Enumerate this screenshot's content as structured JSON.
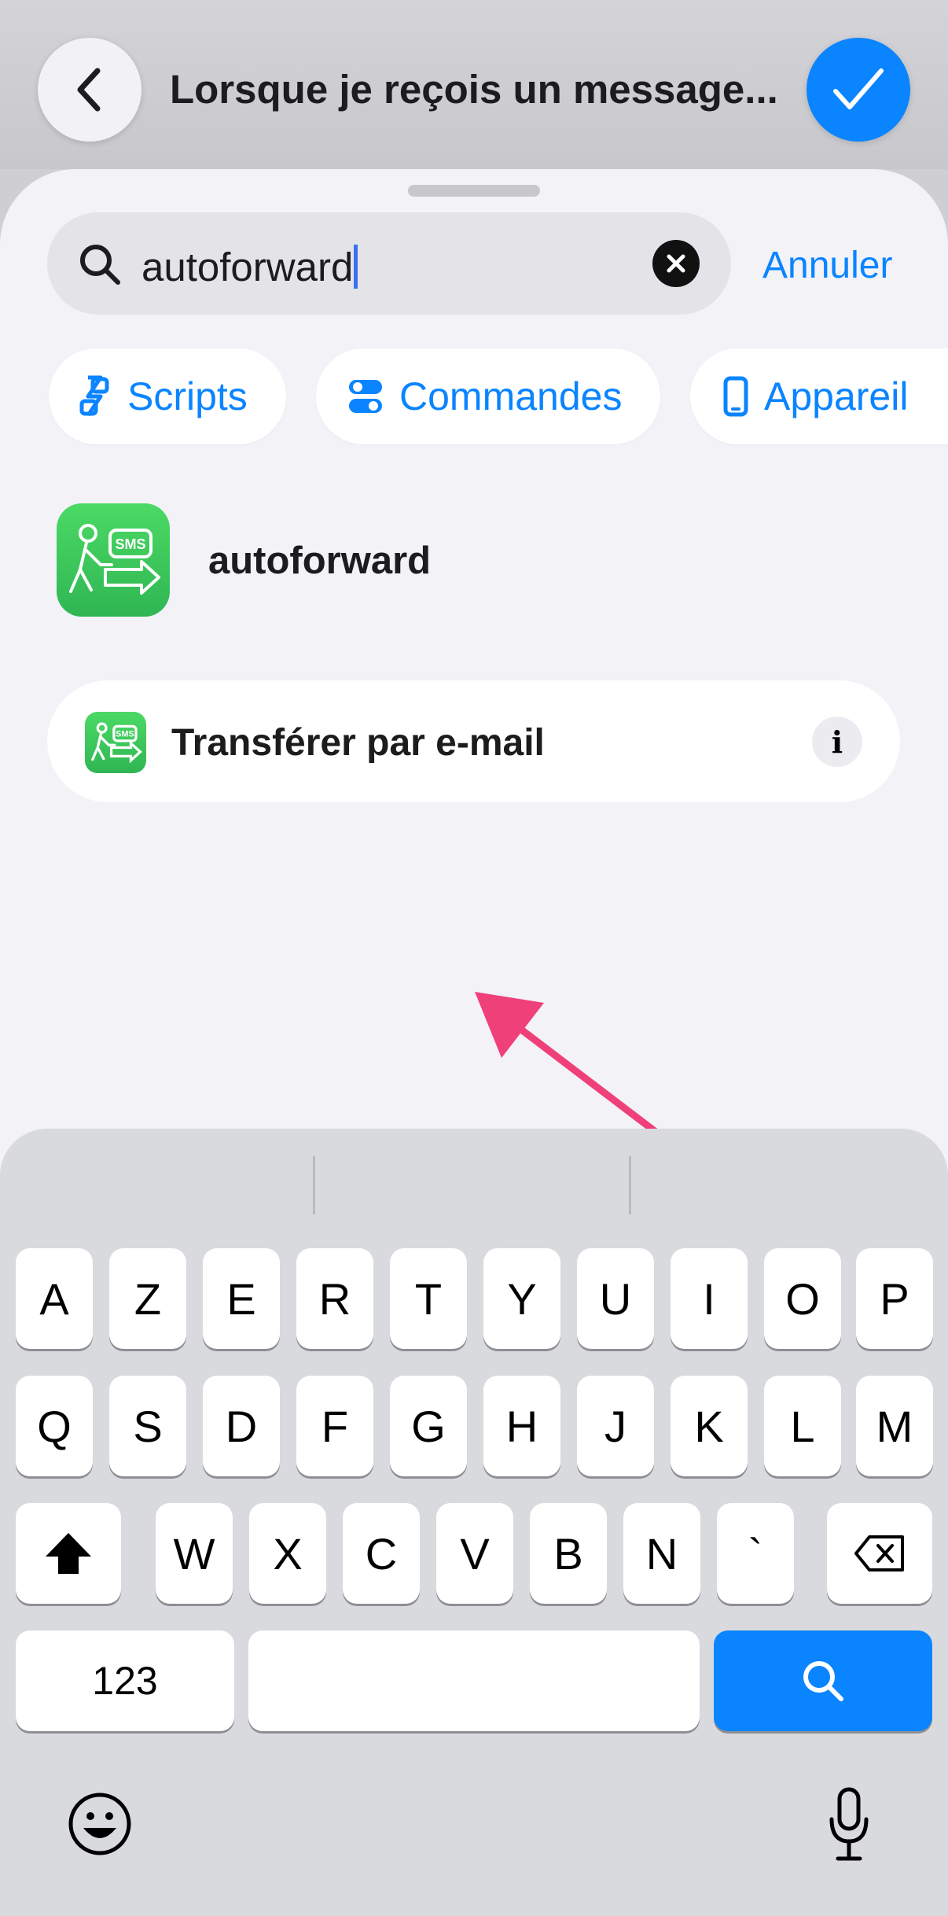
{
  "header": {
    "title": "Lorsque je reçois un message...",
    "back_icon": "chevron-left-icon",
    "done_icon": "checkmark-icon"
  },
  "search": {
    "query": "autoforward",
    "cancel_label": "Annuler",
    "clear_icon": "xmark-circle-icon"
  },
  "chips": [
    {
      "label": "Scripts",
      "icon": "scripts-icon"
    },
    {
      "label": "Commandes",
      "icon": "toggles-icon"
    },
    {
      "label": "Appareil",
      "icon": "phone-icon"
    }
  ],
  "app": {
    "name": "autoforward",
    "icon_text": "SMS"
  },
  "action": {
    "label": "Transférer par e-mail",
    "info_label": "i"
  },
  "annotation": {
    "arrow_color": "#f0407a"
  },
  "keyboard": {
    "row1": [
      "A",
      "Z",
      "E",
      "R",
      "T",
      "Y",
      "U",
      "I",
      "O",
      "P"
    ],
    "row2": [
      "Q",
      "S",
      "D",
      "F",
      "G",
      "H",
      "J",
      "K",
      "L",
      "M"
    ],
    "row3": [
      "W",
      "X",
      "C",
      "V",
      "B",
      "N",
      "`"
    ],
    "numbers_label": "123",
    "accent_color": "#0a84ff"
  }
}
